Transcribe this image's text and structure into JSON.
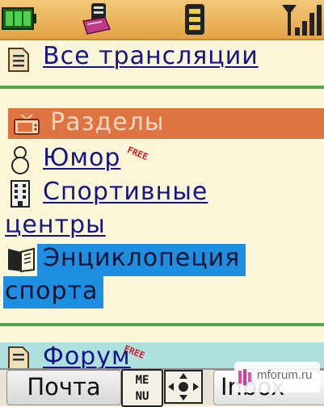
{
  "status_bar": {
    "icons": [
      "battery-icon",
      "inbox-icon",
      "sim-card-icon",
      "signal-strength-icon"
    ]
  },
  "menu": {
    "all_broadcasts": "Все трансляции",
    "section_header": "Разделы",
    "items": [
      {
        "label": "Юмор",
        "badge": "FREE",
        "icon": "person-icon"
      },
      {
        "label_line1": "Спортивные",
        "label_line2": "центры",
        "icon": "building-icon"
      },
      {
        "label_line1": "Энциклопеция",
        "label_line2": "спорта",
        "icon": "book-icon",
        "selected": true
      }
    ],
    "forum": {
      "label": "Форум",
      "badge": "FREE",
      "icon": "document-icon"
    }
  },
  "softkeys": {
    "left": "Почта",
    "menu_key": "MENU",
    "right": "Inbox"
  },
  "watermark": "mforum.ru",
  "colors": {
    "background": "#fbf6d8",
    "link": "#13138f",
    "section_header": "#de7441",
    "selection": "#1e8fe0",
    "separator": "#53a74a",
    "status_bar": "#eab25a"
  }
}
